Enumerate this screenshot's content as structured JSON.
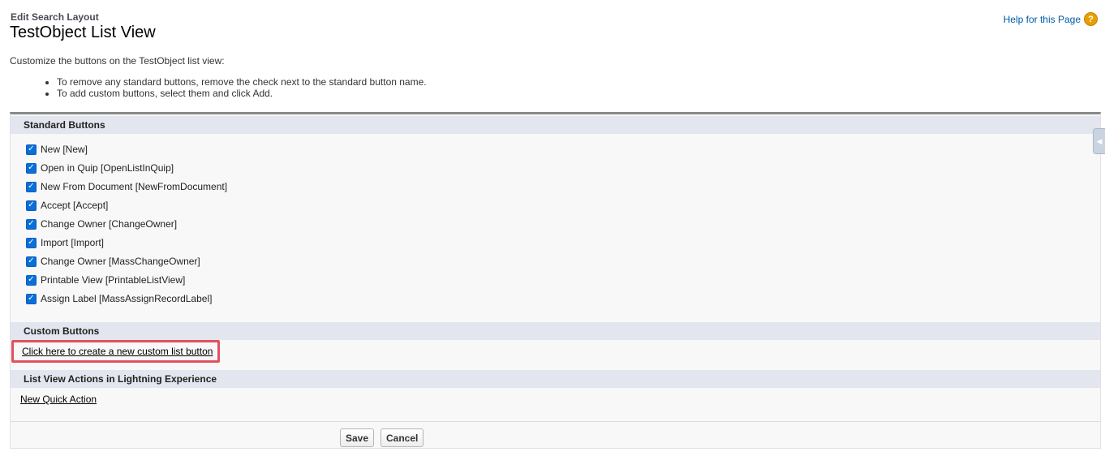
{
  "header": {
    "page_type": "Edit Search Layout",
    "title": "TestObject List View",
    "help_link": "Help for this Page",
    "help_icon": "?"
  },
  "intro": {
    "text": "Customize the buttons on the TestObject list view:",
    "bullets": [
      "To remove any standard buttons, remove the check next to the standard button name.",
      "To add custom buttons, select them and click Add."
    ]
  },
  "standard_buttons": {
    "header": "Standard Buttons",
    "items": [
      {
        "label": "New [New]",
        "checked": true
      },
      {
        "label": "Open in Quip [OpenListInQuip]",
        "checked": true
      },
      {
        "label": "New From Document [NewFromDocument]",
        "checked": true
      },
      {
        "label": "Accept [Accept]",
        "checked": true
      },
      {
        "label": "Change Owner [ChangeOwner]",
        "checked": true
      },
      {
        "label": "Import [Import]",
        "checked": true
      },
      {
        "label": "Change Owner [MassChangeOwner]",
        "checked": true
      },
      {
        "label": "Printable View [PrintableListView]",
        "checked": true
      },
      {
        "label": "Assign Label [MassAssignRecordLabel]",
        "checked": true
      }
    ]
  },
  "custom_buttons": {
    "header": "Custom Buttons",
    "create_link": "Click here to create a new custom list button"
  },
  "list_view_actions": {
    "header": "List View Actions in Lightning Experience",
    "new_quick_action": "New Quick Action"
  },
  "footer": {
    "save_label": "Save",
    "cancel_label": "Cancel"
  },
  "colors": {
    "highlight": "#e0525d",
    "section_header_bg": "#e3e6ef",
    "checkbox": "#0a6fd6",
    "help_link": "#015ba7"
  }
}
